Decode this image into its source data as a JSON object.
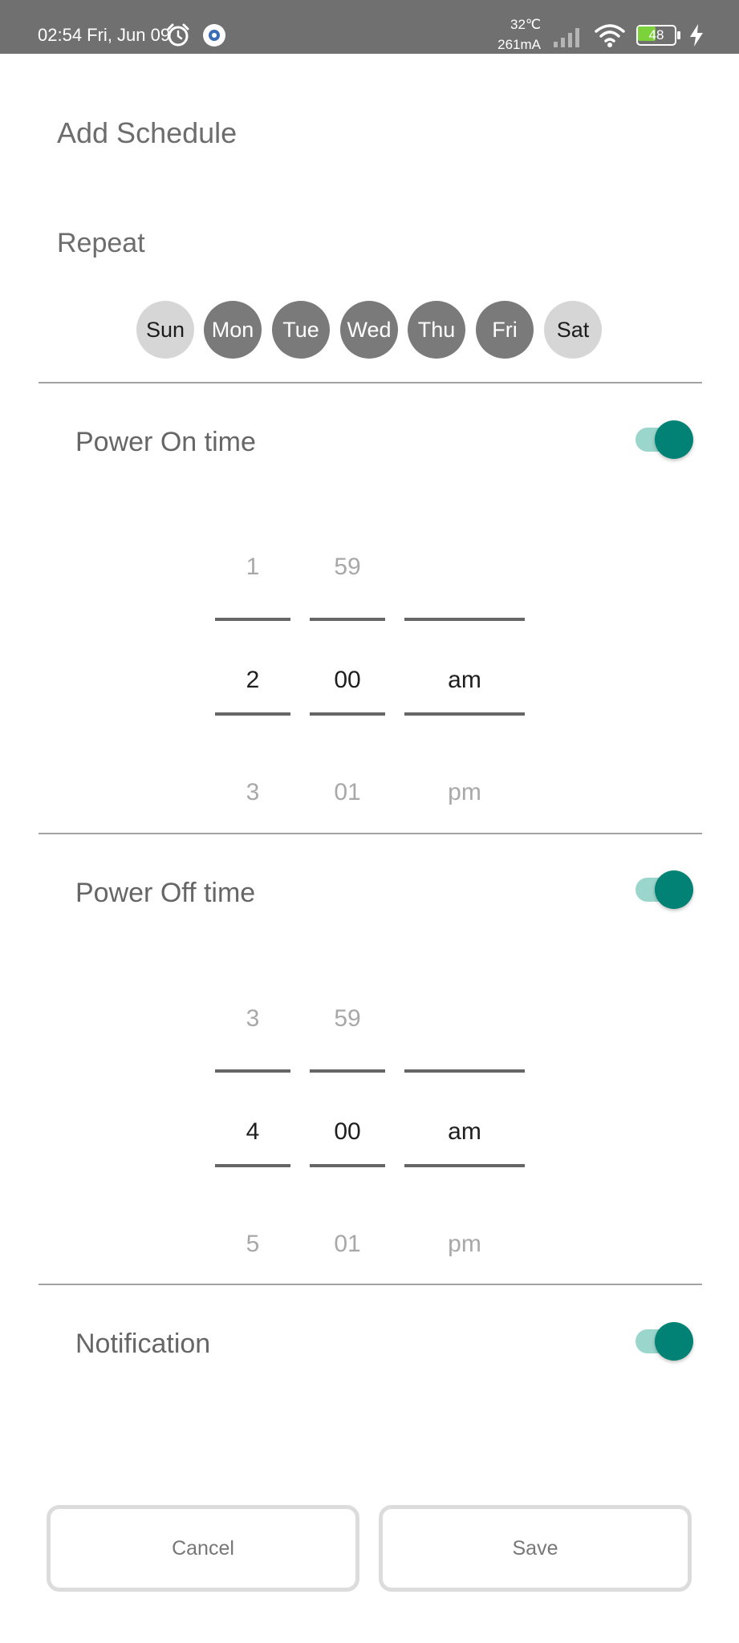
{
  "status_bar": {
    "time": "02:54 Fri, Jun 09",
    "temperature": "32℃",
    "current": "261mA",
    "battery": "48",
    "icons": [
      "alarm-icon",
      "app-notification-icon",
      "signal-icon",
      "wifi-icon",
      "battery-icon",
      "charging-icon"
    ]
  },
  "page": {
    "title": "Add Schedule",
    "repeat_label": "Repeat"
  },
  "days": [
    {
      "label": "Sun",
      "selected": false
    },
    {
      "label": "Mon",
      "selected": true
    },
    {
      "label": "Tue",
      "selected": true
    },
    {
      "label": "Wed",
      "selected": true
    },
    {
      "label": "Thu",
      "selected": true
    },
    {
      "label": "Fri",
      "selected": true
    },
    {
      "label": "Sat",
      "selected": false
    }
  ],
  "power_on": {
    "label": "Power On time",
    "enabled": true,
    "hour": {
      "prev": "1",
      "current": "2",
      "next": "3"
    },
    "minute": {
      "prev": "59",
      "current": "00",
      "next": "01"
    },
    "period": {
      "prev": "",
      "current": "am",
      "next": "pm"
    }
  },
  "power_off": {
    "label": "Power Off time",
    "enabled": true,
    "hour": {
      "prev": "3",
      "current": "4",
      "next": "5"
    },
    "minute": {
      "prev": "59",
      "current": "00",
      "next": "01"
    },
    "period": {
      "prev": "",
      "current": "am",
      "next": "pm"
    }
  },
  "notification": {
    "label": "Notification",
    "enabled": true
  },
  "buttons": {
    "cancel": "Cancel",
    "save": "Save"
  },
  "colors": {
    "status_bar": "#707070",
    "day_selected": "#7a7a7a",
    "day_unselected": "#d6d6d6",
    "toggle_thumb": "#018274",
    "toggle_track": "#9ad6cc",
    "battery_fill": "#7cd23a"
  }
}
